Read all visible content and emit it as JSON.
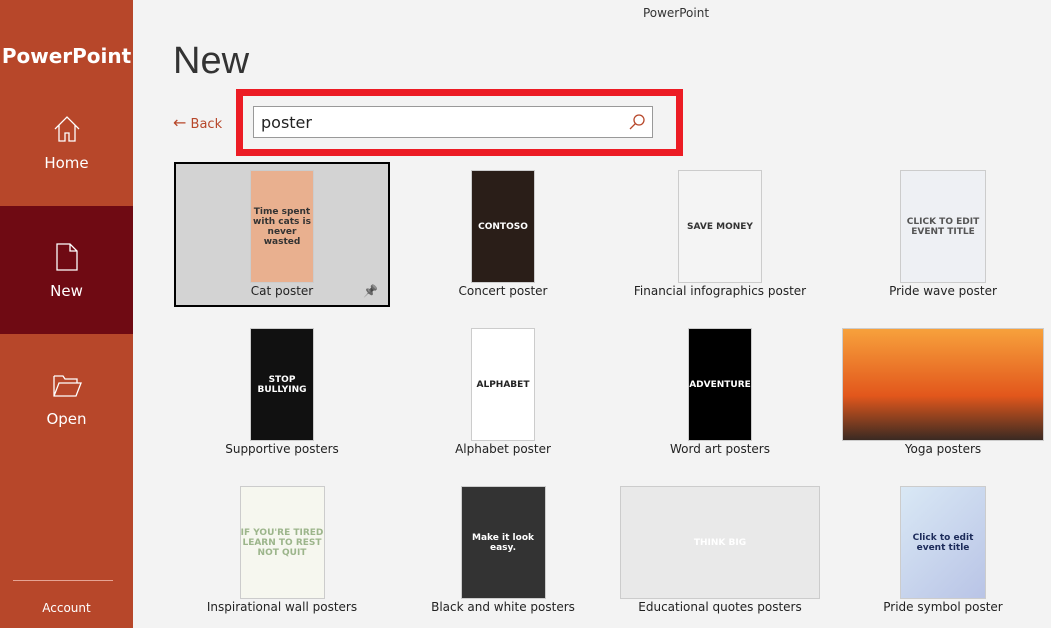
{
  "app_title": "PowerPoint",
  "sidebar": {
    "brand": "PowerPoint",
    "items": [
      {
        "label": "Home",
        "icon": "home-icon"
      },
      {
        "label": "New",
        "icon": "new-document-icon",
        "selected": true
      },
      {
        "label": "Open",
        "icon": "folder-open-icon"
      }
    ],
    "account": "Account"
  },
  "page_title": "New",
  "back_label": "Back",
  "search": {
    "value": "poster"
  },
  "colors": {
    "sidebar": "#b7472a",
    "selected": "#6f0a13",
    "highlight": "#ec1c24"
  },
  "templates": [
    {
      "label": "Cat poster",
      "thumb_text": "Time spent with cats is never wasted",
      "selected": true
    },
    {
      "label": "Concert poster",
      "thumb_text": "CONTOSO"
    },
    {
      "label": "Financial infographics poster",
      "thumb_text": "SAVE MONEY"
    },
    {
      "label": "Pride wave poster",
      "thumb_text": "CLICK TO EDIT EVENT TITLE"
    },
    {
      "label": "Supportive posters",
      "thumb_text": "STOP BULLYING"
    },
    {
      "label": "Alphabet poster",
      "thumb_text": "ALPHABET"
    },
    {
      "label": "Word art posters",
      "thumb_text": "ADVENTURE"
    },
    {
      "label": "Yoga posters",
      "thumb_text": ""
    },
    {
      "label": "Inspirational wall posters",
      "thumb_text": "IF YOU'RE TIRED LEARN TO REST NOT QUIT"
    },
    {
      "label": "Black and white posters",
      "thumb_text": "Make it look easy."
    },
    {
      "label": "Educational quotes posters",
      "thumb_text": "THINK BIG"
    },
    {
      "label": "Pride symbol poster",
      "thumb_text": "Click to edit event title"
    }
  ]
}
